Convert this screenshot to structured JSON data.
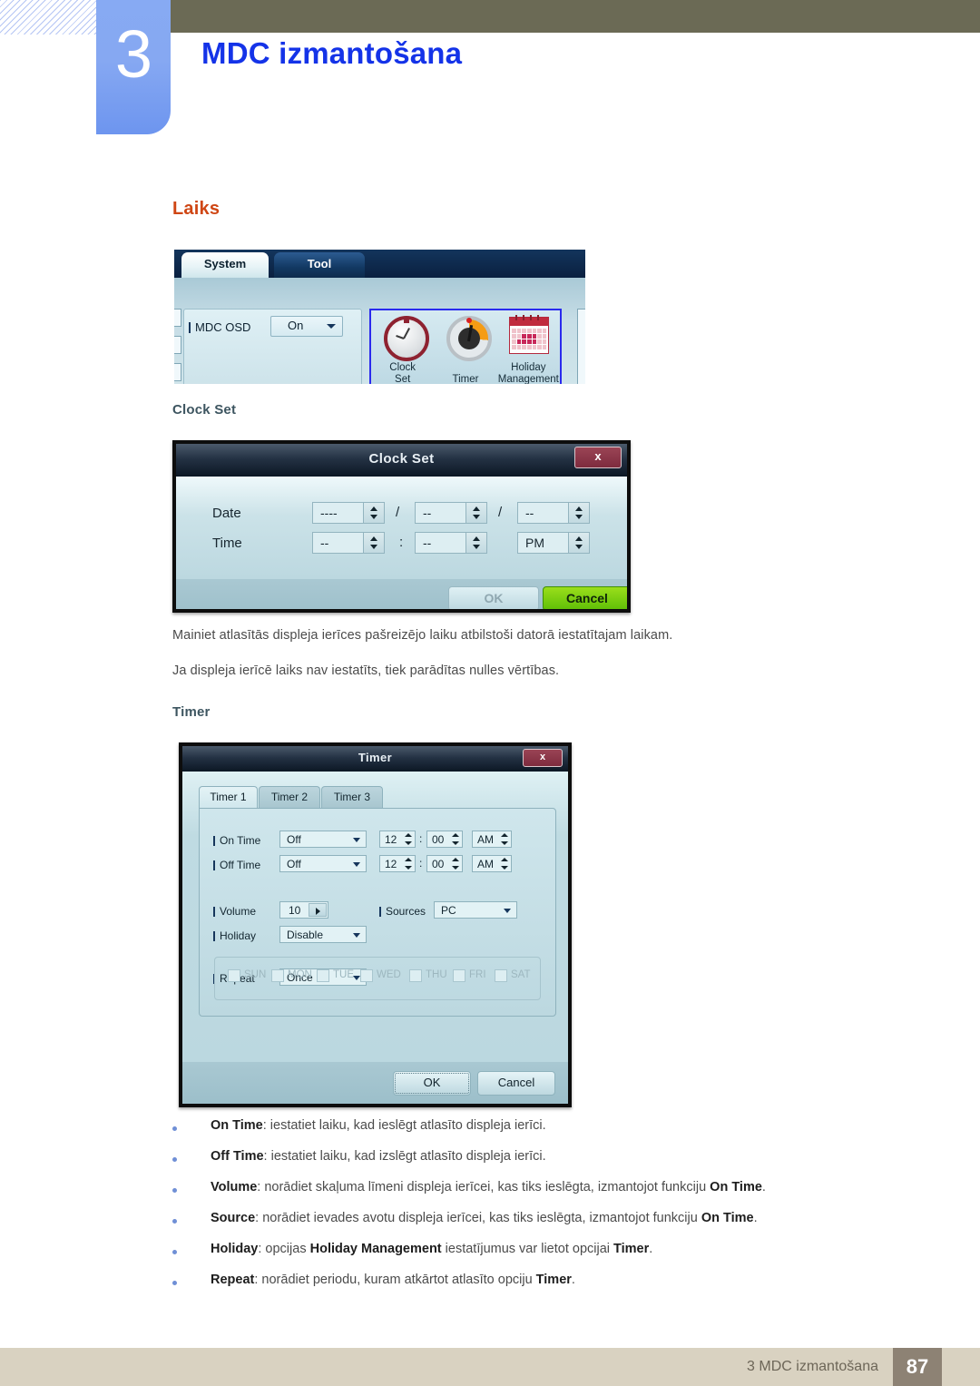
{
  "header": {
    "chapter_number": "3",
    "chapter_title": "MDC izmantošana"
  },
  "section": {
    "heading": "Laiks",
    "sub_clock_set": "Clock Set",
    "sub_timer": "Timer",
    "para1": "Mainiet atlasītās displeja ierīces pašreizējo laiku atbilstoši datorā iestatītajam laikam.",
    "para2": "Ja displeja ierīcē laiks nav iestatīts, tiek parādītas nulles vērtības."
  },
  "mdc_screenshot": {
    "tabs": [
      "System",
      "Tool"
    ],
    "osd_label": "MDC OSD",
    "osd_value": "On",
    "icons": [
      {
        "name": "clock-set-icon",
        "line1": "Clock",
        "line2": "Set"
      },
      {
        "name": "timer-icon",
        "line1": "Timer",
        "line2": ""
      },
      {
        "name": "holiday-management-icon",
        "line1": "Holiday",
        "line2": "Management"
      }
    ],
    "highlight_color": "#2a2aee"
  },
  "clock_set_dialog": {
    "title": "Clock Set",
    "close_label": "x",
    "date_label": "Date",
    "time_label": "Time",
    "date_year": "----",
    "date_month": "--",
    "date_day": "--",
    "time_hour": "--",
    "time_minute": "--",
    "time_ampm": "PM",
    "sep_slash": "/",
    "sep_colon": ":",
    "ok_label": "OK",
    "cancel_label": "Cancel",
    "cancel_color": "#7ecf10"
  },
  "timer_dialog": {
    "title": "Timer",
    "close_label": "x",
    "tabs": [
      "Timer 1",
      "Timer 2",
      "Timer 3"
    ],
    "rows": {
      "on_time_label": "On Time",
      "on_time_mode": "Off",
      "on_time_hour": "12",
      "on_time_min": "00",
      "on_time_ampm": "AM",
      "off_time_label": "Off Time",
      "off_time_mode": "Off",
      "off_time_hour": "12",
      "off_time_min": "00",
      "off_time_ampm": "AM",
      "volume_label": "Volume",
      "volume_value": "10",
      "sources_label": "Sources",
      "sources_value": "PC",
      "holiday_label": "Holiday",
      "holiday_value": "Disable",
      "repeat_label": "Repeat",
      "repeat_value": "Once",
      "colon": ":"
    },
    "days": [
      "SUN",
      "MON",
      "TUE",
      "WED",
      "THU",
      "FRI",
      "SAT"
    ],
    "ok_label": "OK",
    "cancel_label": "Cancel"
  },
  "bullets": [
    {
      "term": "On Time",
      "rest": ": iestatiet laiku, kad ieslēgt atlasīto displeja ierīci."
    },
    {
      "term": "Off Time",
      "rest": ": iestatiet laiku, kad izslēgt atlasīto displeja ierīci."
    },
    {
      "term": "Volume",
      "rest": ": norādiet skaļuma līmeni displeja ierīcei, kas tiks ieslēgta, izmantojot funkciju ",
      "term2": "On Time",
      "rest2": "."
    },
    {
      "term": "Source",
      "rest": ": norādiet ievades avotu displeja ierīcei, kas tiks ieslēgta, izmantojot funkciju ",
      "term2": "On Time",
      "rest2": "."
    },
    {
      "term": "Holiday",
      "rest": ": opcijas ",
      "term2": "Holiday Management",
      "rest2": " iestatījumus var lietot opcijai ",
      "term3": "Timer",
      "rest3": "."
    },
    {
      "term": "Repeat",
      "rest": ": norādiet periodu, kuram atkārtot atlasīto opciju ",
      "term2": "Timer",
      "rest2": "."
    }
  ],
  "footer": {
    "text": "3 MDC izmantošana",
    "page": "87"
  }
}
